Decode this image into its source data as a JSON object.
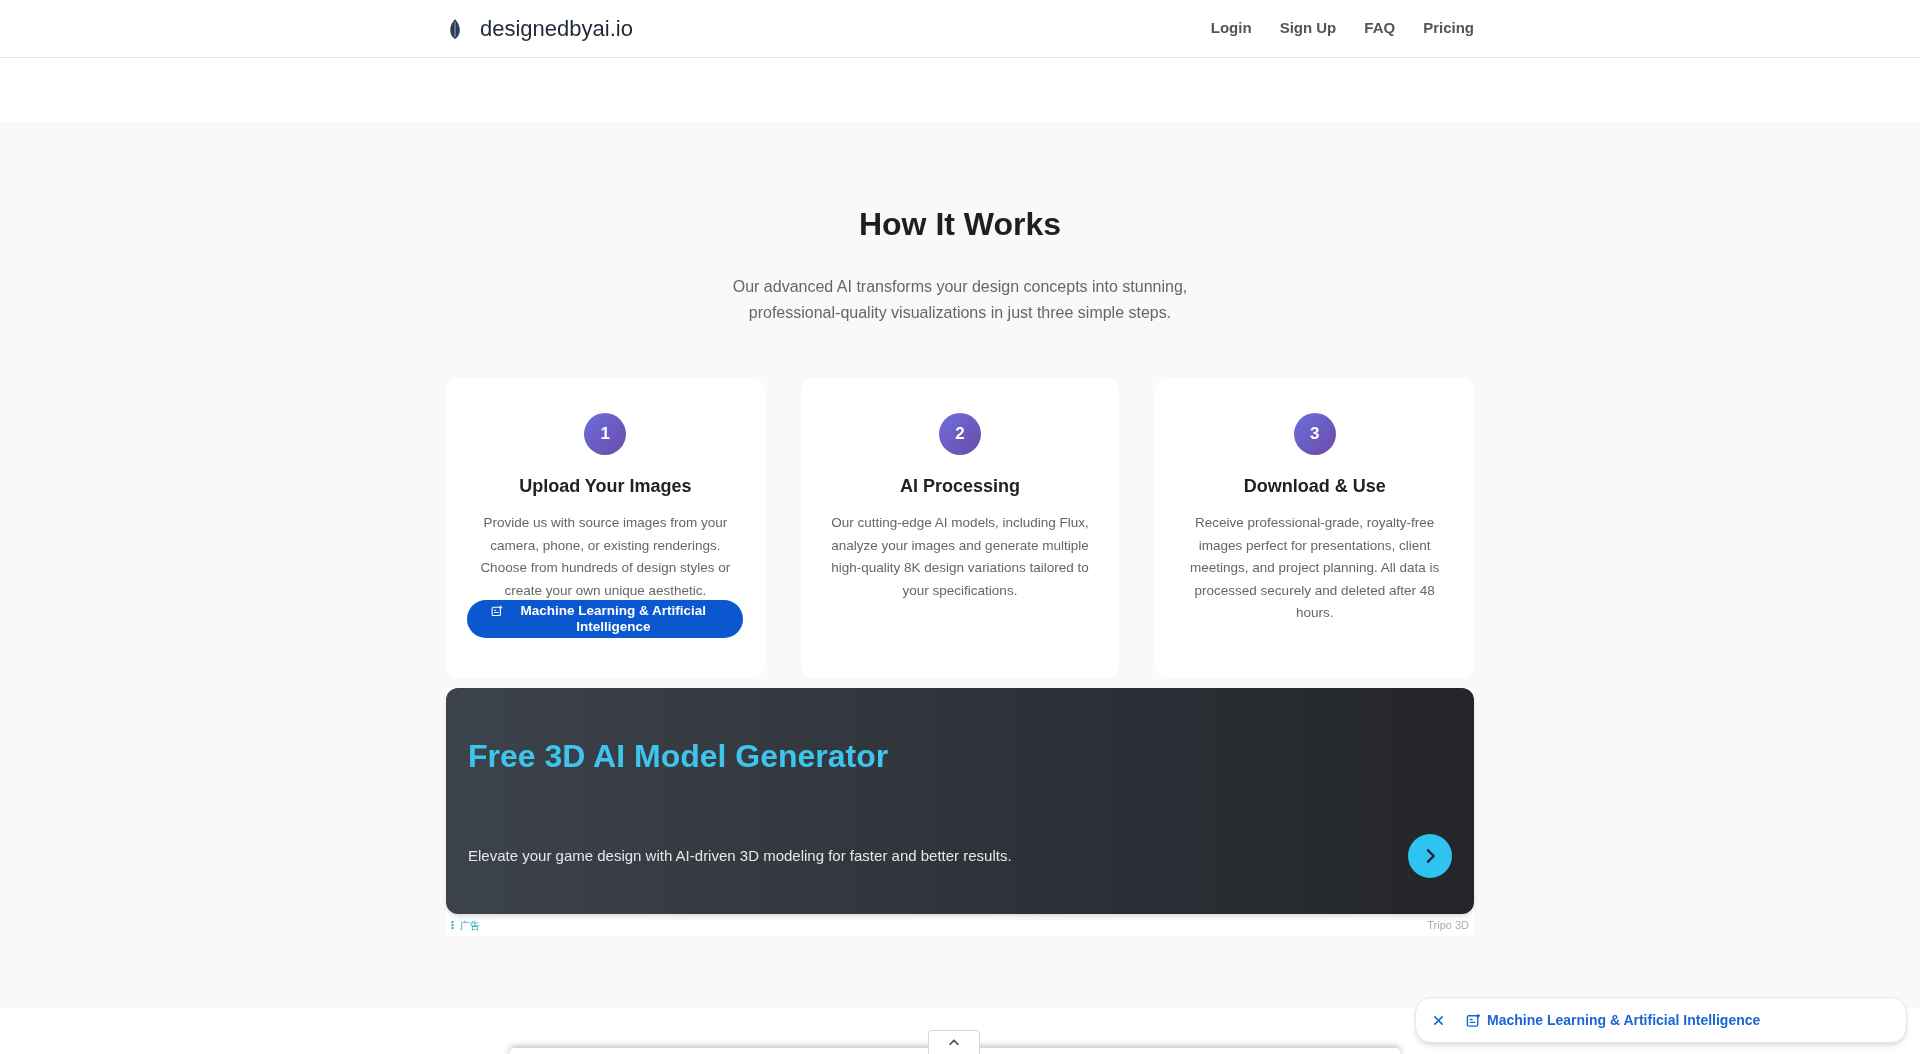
{
  "header": {
    "brand": "designedbyai.io",
    "nav": [
      "Login",
      "Sign Up",
      "FAQ",
      "Pricing"
    ]
  },
  "section": {
    "title": "How It Works",
    "subtitle_lines": [
      "Our advanced AI transforms your design concepts into stunning,",
      "professional-quality visualizations in just three simple steps."
    ],
    "steps": [
      {
        "number": "1",
        "title": "Upload Your Images",
        "text": "Provide us with source images from your camera, phone, or existing renderings. Choose from hundreds of design styles or create your own unique aesthetic.",
        "chip": "Machine Learning & Artificial Intelligence"
      },
      {
        "number": "2",
        "title": "AI Processing",
        "text": "Our cutting-edge AI models, including Flux, analyze your images and generate multiple high-quality 8K design variations tailored to your specifications."
      },
      {
        "number": "3",
        "title": "Download & Use",
        "text": "Receive professional-grade, royalty-free images perfect for presentations, client meetings, and project planning. All data is processed securely and deleted after 48 hours."
      }
    ]
  },
  "ad": {
    "title": "Free 3D AI Model Generator",
    "text": "Elevate your game design with AI-driven 3D modeling for faster and better results.",
    "label": "广告",
    "advertiser": "Tripo 3D"
  },
  "bottom_bar": {
    "chip": "Machine Learning & Artificial Intelligence"
  }
}
